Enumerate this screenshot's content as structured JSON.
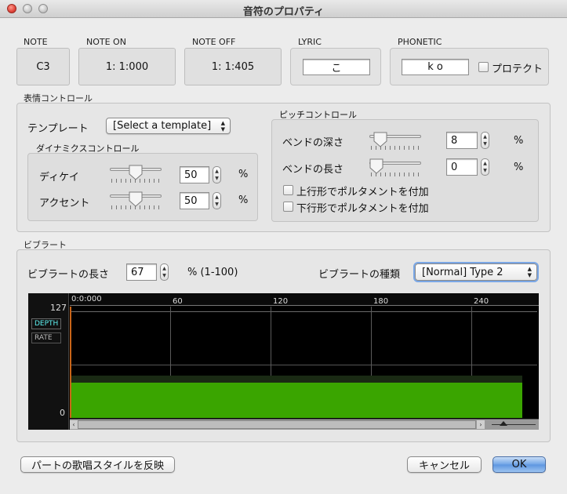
{
  "window": {
    "title": "音符のプロパティ"
  },
  "note_fields": {
    "note": {
      "label": "NOTE",
      "value": "C3"
    },
    "note_on": {
      "label": "NOTE ON",
      "value": "1: 1:000"
    },
    "note_off": {
      "label": "NOTE OFF",
      "value": "1: 1:405"
    },
    "lyric": {
      "label": "LYRIC",
      "value": "こ"
    },
    "phonetic": {
      "label": "PHONETIC",
      "value": "k o",
      "protect_label": "プロテクト"
    }
  },
  "expression": {
    "header": "表情コントロール",
    "template_label": "テンプレート",
    "template_value": "[Select a template]",
    "dynamics": {
      "header": "ダイナミクスコントロール",
      "decay": {
        "label": "ディケイ",
        "value": "50",
        "unit": "%",
        "level": 50
      },
      "accent": {
        "label": "アクセント",
        "value": "50",
        "unit": "%",
        "level": 50
      }
    },
    "pitch": {
      "header": "ピッチコントロール",
      "bend_depth": {
        "label": "ベンドの深さ",
        "value": "8",
        "unit": "%",
        "level": 8
      },
      "bend_length": {
        "label": "ベンドの長さ",
        "value": "0",
        "unit": "%",
        "level": 0
      },
      "upward_portamento": "上行形でポルタメントを付加",
      "downward_portamento": "下行形でポルタメントを付加"
    }
  },
  "vibrato": {
    "header": "ビブラート",
    "length_label": "ビブラートの長さ",
    "length_value": "67",
    "length_unit": "% (1-100)",
    "type_label": "ビブラートの種類",
    "type_value": "[Normal] Type 2",
    "graph": {
      "y_max": "127",
      "y_min": "0",
      "tabs": [
        "DEPTH",
        "RATE"
      ],
      "x_ticks": [
        "0:0:000",
        "60",
        "120",
        "180",
        "240"
      ],
      "depth_level_fraction": 0.32,
      "bar_color": "#3aa500",
      "accent_color": "#5ef0f0"
    }
  },
  "footer": {
    "apply_style_label": "パートの歌唱スタイルを反映",
    "cancel_label": "キャンセル",
    "ok_label": "OK"
  }
}
